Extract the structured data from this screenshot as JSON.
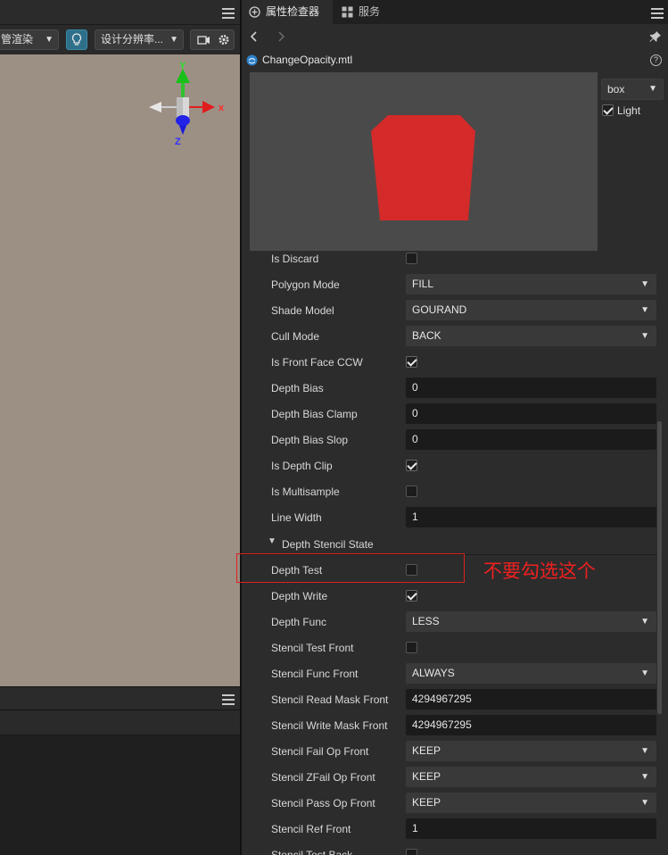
{
  "scene_panel": {
    "render_mode_select": "管渲染",
    "resolution_select": "设计分辨率...",
    "gizmo": {
      "x_label": "x",
      "y_label": "Y",
      "z_label": "Z"
    }
  },
  "inspector": {
    "tabs": [
      {
        "label": "属性检查器",
        "active": true
      },
      {
        "label": "服务",
        "active": false
      }
    ],
    "file_name": "ChangeOpacity.mtl",
    "help_label": "?",
    "preview": {
      "mesh_select": "box",
      "light_label": "Light",
      "light_checked": true,
      "mesh_color": "#d42a2a"
    },
    "properties": [
      {
        "label": "Is Discard",
        "type": "checkbox",
        "checked": false
      },
      {
        "label": "Polygon Mode",
        "type": "select",
        "value": "FILL"
      },
      {
        "label": "Shade Model",
        "type": "select",
        "value": "GOURAND"
      },
      {
        "label": "Cull Mode",
        "type": "select",
        "value": "BACK"
      },
      {
        "label": "Is Front Face CCW",
        "type": "checkbox",
        "checked": true
      },
      {
        "label": "Depth Bias",
        "type": "number",
        "value": "0"
      },
      {
        "label": "Depth Bias Clamp",
        "type": "number",
        "value": "0"
      },
      {
        "label": "Depth Bias Slop",
        "type": "number",
        "value": "0"
      },
      {
        "label": "Is Depth Clip",
        "type": "checkbox",
        "checked": true
      },
      {
        "label": "Is Multisample",
        "type": "checkbox",
        "checked": false
      },
      {
        "label": "Line Width",
        "type": "number",
        "value": "1"
      }
    ],
    "section": {
      "label": "Depth Stencil State"
    },
    "stencil_properties": [
      {
        "label": "Depth Test",
        "type": "checkbox",
        "checked": false
      },
      {
        "label": "Depth Write",
        "type": "checkbox",
        "checked": true
      },
      {
        "label": "Depth Func",
        "type": "select",
        "value": "LESS"
      },
      {
        "label": "Stencil Test Front",
        "type": "checkbox",
        "checked": false
      },
      {
        "label": "Stencil Func Front",
        "type": "select",
        "value": "ALWAYS"
      },
      {
        "label": "Stencil Read Mask Front",
        "type": "number",
        "value": "4294967295"
      },
      {
        "label": "Stencil Write Mask Front",
        "type": "number",
        "value": "4294967295"
      },
      {
        "label": "Stencil Fail Op Front",
        "type": "select",
        "value": "KEEP"
      },
      {
        "label": "Stencil ZFail Op Front",
        "type": "select",
        "value": "KEEP"
      },
      {
        "label": "Stencil Pass Op Front",
        "type": "select",
        "value": "KEEP"
      },
      {
        "label": "Stencil Ref Front",
        "type": "number",
        "value": "1"
      },
      {
        "label": "Stencil Test Back",
        "type": "checkbox",
        "checked": false
      }
    ]
  },
  "annotation": {
    "text": "不要勾选这个",
    "color": "#e02020"
  }
}
